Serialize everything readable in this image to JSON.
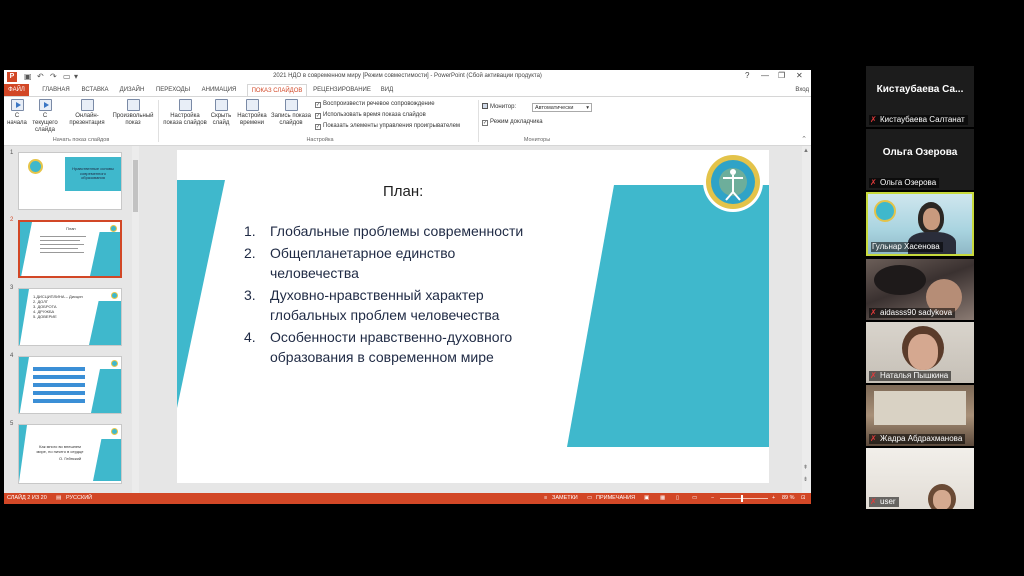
{
  "window": {
    "title": "2021 НДО в современном миру [Режим совместимости] - PowerPoint (Сбой активации продукта)",
    "signin": "Вход",
    "controls": {
      "help": "?",
      "minimize": "—",
      "restore": "❐",
      "close": "✕"
    }
  },
  "tabs": [
    {
      "label": "ФАЙЛ"
    },
    {
      "label": "ГЛАВНАЯ"
    },
    {
      "label": "ВСТАВКА"
    },
    {
      "label": "ДИЗАЙН"
    },
    {
      "label": "ПЕРЕХОДЫ"
    },
    {
      "label": "АНИМАЦИЯ"
    },
    {
      "label": "ПОКАЗ СЛАЙДОВ"
    },
    {
      "label": "РЕЦЕНЗИРОВАНИЕ"
    },
    {
      "label": "ВИД"
    }
  ],
  "ribbon": {
    "start_show": {
      "from_start": "С начала",
      "from_current": "С текущего слайда",
      "online": "Онлайн-презентация",
      "custom": "Произвольный показ",
      "group_label": "Начать показ слайдов"
    },
    "setup": {
      "setup_show": "Настройка показа слайдов",
      "hide_slide": "Скрыть слайд",
      "rehearse": "Настройка времени",
      "record": "Запись показа слайдов",
      "play_narrations": "Воспроизвести речевое сопровождение",
      "use_timings": "Использовать время показа слайдов",
      "show_controls": "Показать элементы управления проигрывателем",
      "group_label": "Настройка"
    },
    "monitors": {
      "monitor_label": "Монитор:",
      "monitor_value": "Автоматически",
      "presenter_view": "Режим докладчика",
      "group_label": "Мониторы"
    }
  },
  "thumbnails": [
    {
      "num": "1",
      "text": "Нравственные основы современного образования"
    },
    {
      "num": "2",
      "text": "План"
    },
    {
      "num": "3",
      "lines": [
        "1.ДИСЦИПЛИНА – Дисцип",
        "2. ДОЛГ",
        "3. ДОБРОТА",
        "4. ДРУЖБА",
        "5. ДОВЕРИЕ"
      ]
    },
    {
      "num": "4"
    },
    {
      "num": "5",
      "quote": "Как много во внешнем мире, но ничего в сердце",
      "author": "О. Гейнский"
    }
  ],
  "slide": {
    "title": "План:",
    "items": [
      {
        "n": "1.",
        "text": "Глобальные проблемы современности"
      },
      {
        "n": "2.",
        "text": "Общепланетарное единство человечества"
      },
      {
        "n": "3.",
        "text": "Духовно-нравственный характер глобальных проблем человечества"
      },
      {
        "n": "4.",
        "text": "Особенности нравственно-духовного образования в современном мире"
      }
    ]
  },
  "status": {
    "slide_counter": "СЛАЙД 2 ИЗ 20",
    "language": "РУССКИЙ",
    "notes": "ЗАМЕТКИ",
    "comments": "ПРИМЕЧАНИЯ",
    "zoom": "89 %"
  },
  "participants": [
    {
      "display_name": "Кистаубаева  Са...",
      "label": "Кистаубаева Салтанат",
      "has_video": false
    },
    {
      "display_name": "Ольга Озерова",
      "label": "Ольга Озерова",
      "has_video": false
    },
    {
      "label": "Гульнар Хасенова",
      "has_video": true,
      "speaking": true
    },
    {
      "label": "aidasss90 sadykova",
      "has_video": true
    },
    {
      "label": "Наталья Пышкина",
      "has_video": true
    },
    {
      "label": "Жадра Абдрахманова",
      "has_video": true
    },
    {
      "label": "user",
      "has_video": true
    }
  ],
  "colors": {
    "accent": "#d24726",
    "teal": "#3fb8cc",
    "speaker_border": "#c7d93c"
  }
}
